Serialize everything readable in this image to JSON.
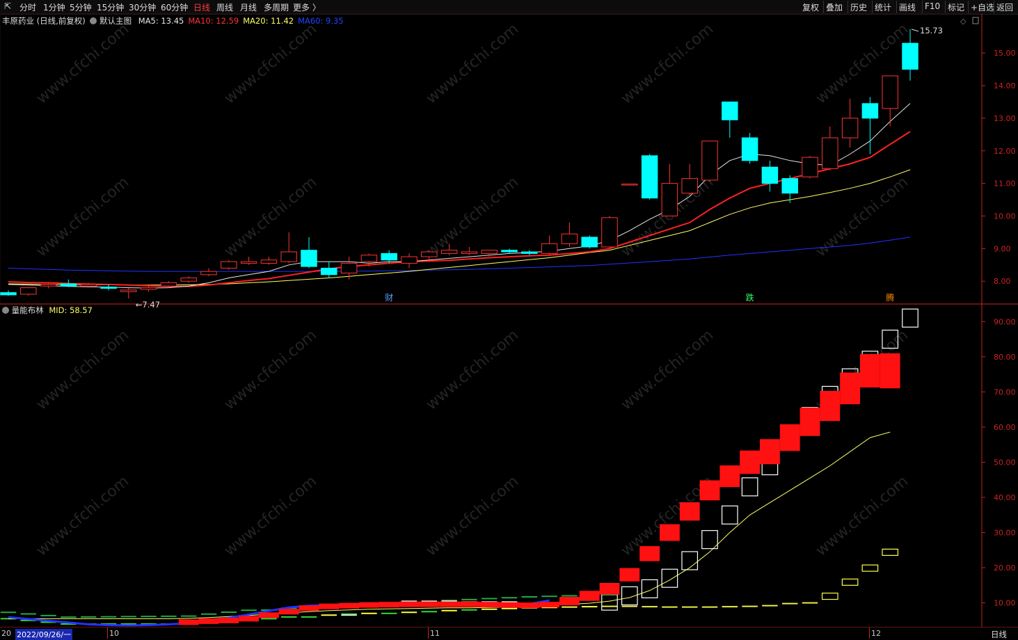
{
  "topbar": {
    "left_icon": "⇱",
    "periods": [
      "分时",
      "1分钟",
      "5分钟",
      "15分钟",
      "30分钟",
      "60分钟",
      "日线",
      "周线",
      "月线",
      "多周期",
      "更多 〉"
    ],
    "active_period": "日线",
    "right_items": [
      "复权",
      "叠加",
      "历史",
      "统计",
      "画线",
      "F10",
      "标记",
      "+自选",
      "返回"
    ]
  },
  "main_panel": {
    "stock_name": "丰原药业",
    "period_note": "(日线,前复权)",
    "template_icon": "gear-icon",
    "template": "默认主图",
    "ma": [
      {
        "label": "MA5:",
        "value": "13.45",
        "color": "#e6e6e6"
      },
      {
        "label": "MA10:",
        "value": "12.59",
        "color": "#ff3333"
      },
      {
        "label": "MA20:",
        "value": "11.42",
        "color": "#ffff66"
      },
      {
        "label": "MA60:",
        "value": "9.35",
        "color": "#2244ff"
      }
    ],
    "high_label": "15.73",
    "low_label": "7.47",
    "markers": [
      {
        "text": "财",
        "color": "#5aa0ff"
      },
      {
        "text": "跌",
        "color": "#33ff66"
      },
      {
        "text": "腾",
        "color": "#ff8800"
      }
    ],
    "price_ticks": [
      "15.00",
      "14.00",
      "13.00",
      "12.00",
      "11.00",
      "10.00",
      "9.00",
      "8.00"
    ]
  },
  "indicator_panel": {
    "name": "量能布林",
    "mid_label": "MID:",
    "mid_value": "58.57",
    "ticks": [
      "90.00",
      "80.00",
      "70.00",
      "60.00",
      "50.00",
      "40.00",
      "30.00",
      "20.00",
      "10.00"
    ]
  },
  "bottom_axis": {
    "first_date": "2022/09/26/一",
    "left_stub": "20",
    "month_labels": [
      "10",
      "11",
      "12"
    ],
    "period_button": "日线"
  },
  "watermark": "www.cfchi.com",
  "colors": {
    "up": "#ff3333",
    "down": "#00ffff",
    "ma5": "#e6e6e6",
    "ma10": "#ff2222",
    "ma20": "#ffff66",
    "ma60": "#2233ff",
    "axis": "#cc2222"
  },
  "chart_data": [
    {
      "type": "candlestick",
      "title": "丰原药业 (日线,前复权)",
      "ylim": [
        7.3,
        16.2
      ],
      "y_ticks": [
        8,
        9,
        10,
        11,
        12,
        13,
        14,
        15
      ],
      "candles": [
        {
          "o": 7.65,
          "h": 7.72,
          "l": 7.55,
          "c": 7.58
        },
        {
          "o": 7.6,
          "h": 7.8,
          "l": 7.55,
          "c": 7.8
        },
        {
          "o": 7.85,
          "h": 7.95,
          "l": 7.78,
          "c": 7.9
        },
        {
          "o": 7.92,
          "h": 8.05,
          "l": 7.82,
          "c": 7.85
        },
        {
          "o": 7.85,
          "h": 7.95,
          "l": 7.8,
          "c": 7.9
        },
        {
          "o": 7.82,
          "h": 7.9,
          "l": 7.72,
          "c": 7.78
        },
        {
          "o": 7.68,
          "h": 7.78,
          "l": 7.47,
          "c": 7.73
        },
        {
          "o": 7.75,
          "h": 7.85,
          "l": 7.68,
          "c": 7.8
        },
        {
          "o": 7.85,
          "h": 8.0,
          "l": 7.8,
          "c": 7.95
        },
        {
          "o": 8.0,
          "h": 8.15,
          "l": 7.95,
          "c": 8.1
        },
        {
          "o": 8.2,
          "h": 8.4,
          "l": 8.15,
          "c": 8.3
        },
        {
          "o": 8.4,
          "h": 8.65,
          "l": 8.35,
          "c": 8.6
        },
        {
          "o": 8.55,
          "h": 8.75,
          "l": 8.5,
          "c": 8.6
        },
        {
          "o": 8.55,
          "h": 8.75,
          "l": 8.5,
          "c": 8.65
        },
        {
          "o": 8.6,
          "h": 9.5,
          "l": 8.55,
          "c": 8.9
        },
        {
          "o": 8.95,
          "h": 9.35,
          "l": 8.4,
          "c": 8.45
        },
        {
          "o": 8.4,
          "h": 8.6,
          "l": 8.1,
          "c": 8.2
        },
        {
          "o": 8.25,
          "h": 8.75,
          "l": 8.05,
          "c": 8.55
        },
        {
          "o": 8.6,
          "h": 8.85,
          "l": 8.45,
          "c": 8.8
        },
        {
          "o": 8.85,
          "h": 8.95,
          "l": 8.55,
          "c": 8.65
        },
        {
          "o": 8.55,
          "h": 8.85,
          "l": 8.4,
          "c": 8.75
        },
        {
          "o": 8.75,
          "h": 8.95,
          "l": 8.6,
          "c": 8.9
        },
        {
          "o": 8.85,
          "h": 9.15,
          "l": 8.8,
          "c": 8.95
        },
        {
          "o": 8.85,
          "h": 9.05,
          "l": 8.8,
          "c": 8.9
        },
        {
          "o": 8.85,
          "h": 8.95,
          "l": 8.75,
          "c": 8.95
        },
        {
          "o": 8.95,
          "h": 9.0,
          "l": 8.85,
          "c": 8.9
        },
        {
          "o": 8.9,
          "h": 8.95,
          "l": 8.8,
          "c": 8.85
        },
        {
          "o": 8.85,
          "h": 9.4,
          "l": 8.8,
          "c": 9.15
        },
        {
          "o": 9.15,
          "h": 9.8,
          "l": 9.05,
          "c": 9.45
        },
        {
          "o": 9.35,
          "h": 9.4,
          "l": 9.0,
          "c": 9.05
        },
        {
          "o": 9.05,
          "h": 10.0,
          "l": 9.0,
          "c": 9.95
        },
        {
          "o": 10.98,
          "h": 10.98,
          "l": 10.98,
          "c": 10.98
        },
        {
          "o": 11.85,
          "h": 11.9,
          "l": 10.5,
          "c": 10.55
        },
        {
          "o": 10.0,
          "h": 11.6,
          "l": 10.0,
          "c": 11.0
        },
        {
          "o": 10.7,
          "h": 11.6,
          "l": 10.65,
          "c": 11.15
        },
        {
          "o": 11.1,
          "h": 12.3,
          "l": 11.05,
          "c": 12.3
        },
        {
          "o": 13.5,
          "h": 13.5,
          "l": 12.4,
          "c": 12.95
        },
        {
          "o": 12.4,
          "h": 12.55,
          "l": 11.6,
          "c": 11.7
        },
        {
          "o": 11.5,
          "h": 11.7,
          "l": 10.75,
          "c": 11.0
        },
        {
          "o": 11.15,
          "h": 11.25,
          "l": 10.4,
          "c": 10.7
        },
        {
          "o": 11.2,
          "h": 11.85,
          "l": 11.15,
          "c": 11.8
        },
        {
          "o": 11.45,
          "h": 12.75,
          "l": 11.4,
          "c": 12.4
        },
        {
          "o": 12.4,
          "h": 13.6,
          "l": 12.1,
          "c": 13.0
        },
        {
          "o": 13.45,
          "h": 13.65,
          "l": 11.9,
          "c": 13.0
        },
        {
          "o": 13.3,
          "h": 13.4,
          "l": 12.75,
          "c": 14.3
        },
        {
          "o": 15.3,
          "h": 15.73,
          "l": 14.15,
          "c": 14.5
        }
      ],
      "series": [
        {
          "name": "MA5",
          "values": [
            7.9,
            7.88,
            7.86,
            7.84,
            7.83,
            7.82,
            7.8,
            7.79,
            7.8,
            7.85,
            7.95,
            8.1,
            8.2,
            8.3,
            8.5,
            8.6,
            8.6,
            8.6,
            8.55,
            8.6,
            8.6,
            8.65,
            8.7,
            8.75,
            8.8,
            8.85,
            8.88,
            8.92,
            9.0,
            9.08,
            9.25,
            9.55,
            9.9,
            10.2,
            10.6,
            11.25,
            11.7,
            11.9,
            11.85,
            11.7,
            11.6,
            11.55,
            11.9,
            12.3,
            12.9,
            13.45
          ]
        },
        {
          "name": "MA10",
          "values": [
            7.98,
            7.96,
            7.95,
            7.93,
            7.91,
            7.9,
            7.88,
            7.86,
            7.84,
            7.84,
            7.88,
            7.95,
            8.02,
            8.08,
            8.18,
            8.28,
            8.38,
            8.45,
            8.5,
            8.55,
            8.6,
            8.62,
            8.64,
            8.68,
            8.72,
            8.75,
            8.78,
            8.8,
            8.85,
            8.9,
            9.0,
            9.2,
            9.4,
            9.6,
            9.8,
            10.2,
            10.55,
            10.85,
            11.0,
            11.15,
            11.3,
            11.45,
            11.6,
            11.8,
            12.2,
            12.59
          ]
        },
        {
          "name": "MA20",
          "values": [
            7.92,
            7.91,
            7.9,
            7.9,
            7.89,
            7.89,
            7.88,
            7.88,
            7.88,
            7.89,
            7.9,
            7.92,
            7.95,
            7.98,
            8.02,
            8.06,
            8.1,
            8.15,
            8.2,
            8.25,
            8.3,
            8.36,
            8.42,
            8.48,
            8.54,
            8.6,
            8.66,
            8.72,
            8.8,
            8.88,
            8.95,
            9.1,
            9.25,
            9.4,
            9.55,
            9.8,
            10.05,
            10.25,
            10.4,
            10.5,
            10.6,
            10.72,
            10.85,
            11.0,
            11.2,
            11.42
          ]
        },
        {
          "name": "MA60",
          "values": [
            8.4,
            8.38,
            8.36,
            8.34,
            8.33,
            8.32,
            8.31,
            8.3,
            8.3,
            8.3,
            8.3,
            8.3,
            8.3,
            8.3,
            8.3,
            8.3,
            8.3,
            8.31,
            8.31,
            8.32,
            8.33,
            8.34,
            8.35,
            8.36,
            8.38,
            8.4,
            8.42,
            8.44,
            8.46,
            8.48,
            8.52,
            8.56,
            8.6,
            8.64,
            8.68,
            8.74,
            8.8,
            8.85,
            8.9,
            8.95,
            9.0,
            9.05,
            9.1,
            9.17,
            9.26,
            9.35
          ]
        }
      ]
    },
    {
      "type": "box-band",
      "title": "量能布林",
      "ylim": [
        3,
        95
      ],
      "y_ticks": [
        10,
        20,
        30,
        40,
        50,
        60,
        70,
        80,
        90
      ],
      "mid_series": {
        "name": "MID",
        "values": [
          5.5,
          5.5,
          5.5,
          5.5,
          5.5,
          5.5,
          5.5,
          5.5,
          5.5,
          5.6,
          5.8,
          6.1,
          6.4,
          6.8,
          7.2,
          7.5,
          7.8,
          8.0,
          8.2,
          8.3,
          8.4,
          8.5,
          8.6,
          8.6,
          8.7,
          8.8,
          9.0,
          9.3,
          9.6,
          9.9,
          10.5,
          11.5,
          13.5,
          16.5,
          20.0,
          24.5,
          30.0,
          35.0,
          38.5,
          42.0,
          45.5,
          49.0,
          53.0,
          57.0,
          58.57
        ]
      },
      "upper": [
        null,
        null,
        null,
        null,
        null,
        null,
        null,
        null,
        null,
        null,
        null,
        null,
        null,
        null,
        null,
        null,
        null,
        6.5,
        9.0,
        10.0,
        10.5,
        10.5,
        10.5,
        10.3,
        10.3,
        10.3,
        9.8,
        10.0,
        null,
        null,
        10.5,
        12.0,
        14.0,
        17.0,
        22.0,
        28.0,
        35.0,
        43.0,
        49.0,
        56.0,
        63.0,
        69.0,
        74.0,
        79.0,
        85.0,
        91.0
      ],
      "lower": [
        5.5,
        5.0,
        4.5,
        4.0,
        4.0,
        4.0,
        4.0,
        4.0,
        4.0,
        4.0,
        4.5,
        5.0,
        5.5,
        5.5,
        6.0,
        6.0,
        6.5,
        6.8,
        7.0,
        7.0,
        7.3,
        7.5,
        7.8,
        8.0,
        8.2,
        8.4,
        8.6,
        8.7,
        8.8,
        8.9,
        9.0,
        9.0,
        8.9,
        8.8,
        8.8,
        8.8,
        8.9,
        9.0,
        9.2,
        9.8,
        10.0,
        11.0,
        15.0,
        19.0,
        23.5
      ],
      "value": [
        6.5,
        6.0,
        5.5,
        5.0,
        4.5,
        4.3,
        4.2,
        4.3,
        4.5,
        4.8,
        5.0,
        5.5,
        6.5,
        7.5,
        8.5,
        9.0,
        9.2,
        9.4,
        9.5,
        9.6,
        9.6,
        9.6,
        9.6,
        9.5,
        9.4,
        9.3,
        9.5,
        10.5,
        12.0,
        14.0,
        18.0,
        24.0,
        30.0,
        36.0,
        42.0,
        46.0,
        50.0,
        53.0,
        57.0,
        61.5,
        66.0,
        71.0,
        76.0,
        76.0
      ]
    }
  ]
}
